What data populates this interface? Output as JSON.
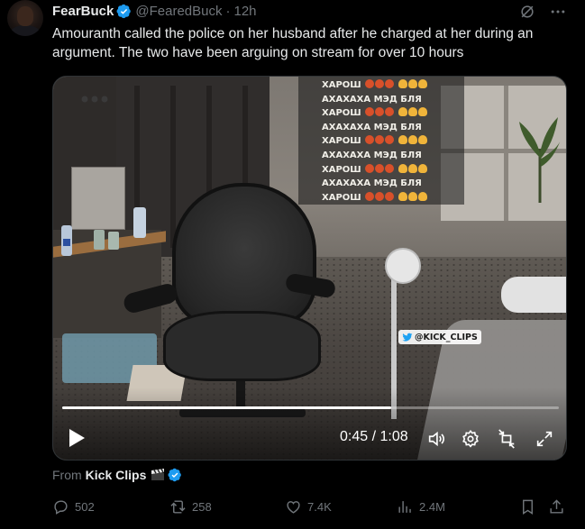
{
  "tweet": {
    "author": {
      "name": "FearBuck",
      "handle": "@FearedBuck",
      "separator": "·",
      "time": "12h",
      "verified": true
    },
    "text": "Amouranth called the police on her husband after he charged at her during an argument. The two have been arguing on stream for over 10 hours",
    "icons": {
      "translate": "no-translate-icon",
      "more": "more-options-icon"
    }
  },
  "video": {
    "chat_overlay": [
      "ХАРОШ",
      "АХАХАХА МЭД БЛЯ",
      "ХАРОШ",
      "АХАХАХА МЭД БЛЯ",
      "ХАРОШ",
      "АХАХАХА МЭД БЛЯ",
      "ХАРОШ",
      "АХАХАХА МЭД БЛЯ",
      "ХАРОШ"
    ],
    "watermark": "@KICK_CLIPS",
    "current_time": "0:45",
    "duration": "1:08",
    "timecode": "0:45 / 1:08",
    "progress_fraction": 0.662,
    "controls": [
      "play-icon",
      "volume-icon",
      "settings-icon",
      "minimize-icon",
      "fullscreen-icon"
    ]
  },
  "source": {
    "prefix": "From",
    "name": "Kick Clips"
  },
  "actions": {
    "replies": "502",
    "reposts": "258",
    "likes": "7.4K",
    "views": "2.4M"
  },
  "colors": {
    "background": "#000000",
    "text": "#e7e9ea",
    "muted": "#71767b",
    "verified": "#1d9bf0",
    "border": "#2f3336"
  }
}
